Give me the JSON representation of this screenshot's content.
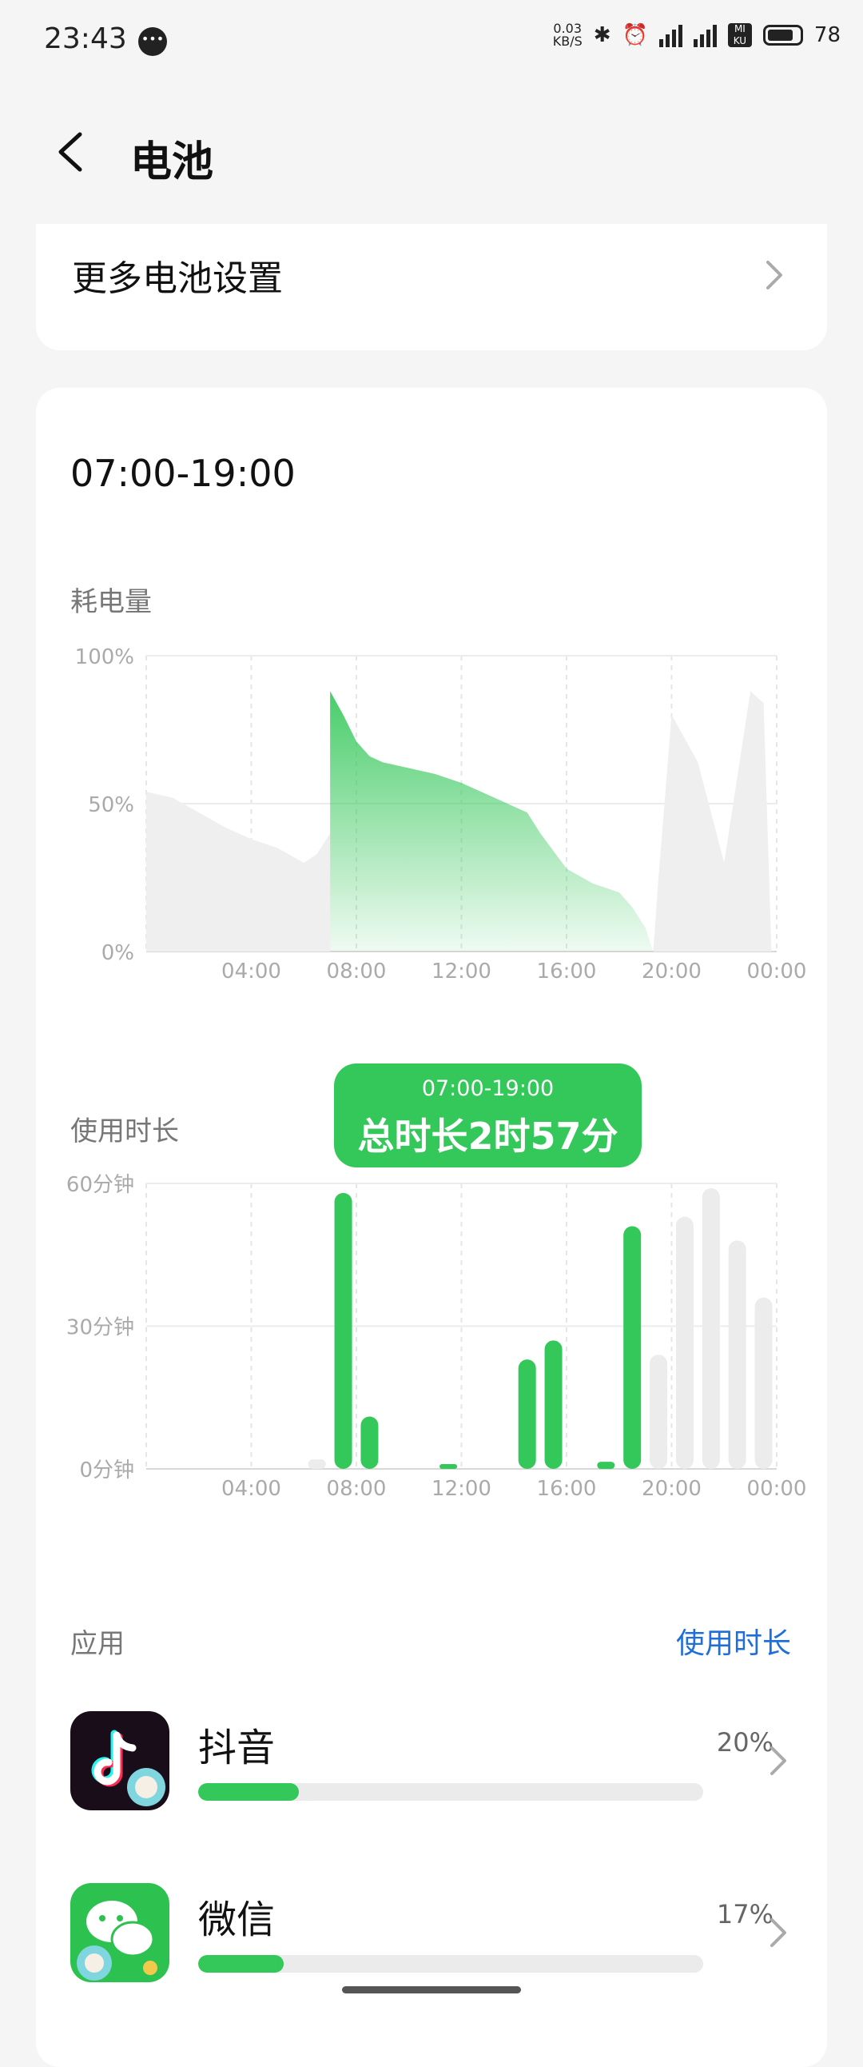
{
  "status_bar": {
    "time": "23:43",
    "net_speed_value": "0.03",
    "net_speed_unit": "KB/S",
    "battery_level": "78",
    "icons": [
      "message-icon",
      "bluetooth-icon",
      "alarm-icon",
      "signal-icon",
      "signal-icon",
      "mi-icon",
      "battery-icon"
    ]
  },
  "header": {
    "title": "电池"
  },
  "more_settings": {
    "label": "更多电池设置"
  },
  "range_label": "07:00-19:00",
  "consumption": {
    "label": "耗电量",
    "chart_data": {
      "type": "area",
      "y_ticks": [
        "100%",
        "50%",
        "0%"
      ],
      "x_ticks": [
        "04:00",
        "08:00",
        "12:00",
        "16:00",
        "20:00",
        "00:00"
      ],
      "ylim": [
        0,
        100
      ],
      "grey_points": [
        [
          0,
          54
        ],
        [
          1,
          52
        ],
        [
          2,
          47
        ],
        [
          3,
          42
        ],
        [
          4,
          38
        ],
        [
          5,
          35
        ],
        [
          6,
          30
        ],
        [
          6.5,
          33
        ],
        [
          7,
          40
        ]
      ],
      "green_points": [
        [
          7,
          88
        ],
        [
          7.5,
          80
        ],
        [
          8,
          71
        ],
        [
          8.5,
          66
        ],
        [
          9,
          64
        ],
        [
          10,
          62
        ],
        [
          11,
          60
        ],
        [
          12,
          57
        ],
        [
          13,
          53
        ],
        [
          14,
          49
        ],
        [
          14.5,
          47
        ],
        [
          15,
          40
        ],
        [
          15.5,
          34
        ],
        [
          16,
          28
        ],
        [
          17,
          23
        ],
        [
          18,
          20
        ],
        [
          18.5,
          15
        ],
        [
          19,
          8
        ],
        [
          19.3,
          0
        ]
      ],
      "grey_future_points": [
        [
          19.3,
          0
        ],
        [
          19.5,
          25
        ],
        [
          20,
          80
        ],
        [
          21,
          64
        ],
        [
          22,
          30
        ],
        [
          23,
          88
        ],
        [
          23.5,
          84
        ],
        [
          23.8,
          0
        ]
      ]
    }
  },
  "usage": {
    "label": "使用时长",
    "tooltip": {
      "range": "07:00-19:00",
      "total": "总时长2时57分"
    },
    "chart_data": {
      "type": "bar",
      "y_ticks": [
        "60分钟",
        "30分钟",
        "0分钟"
      ],
      "x_ticks": [
        "04:00",
        "08:00",
        "12:00",
        "16:00",
        "20:00",
        "00:00"
      ],
      "ylim": [
        0,
        60
      ],
      "bars": [
        {
          "hour": 6,
          "minutes": 2,
          "active": false
        },
        {
          "hour": 7,
          "minutes": 58,
          "active": true
        },
        {
          "hour": 8,
          "minutes": 11,
          "active": true
        },
        {
          "hour": 11,
          "minutes": 0.5,
          "active": true
        },
        {
          "hour": 14,
          "minutes": 23,
          "active": true
        },
        {
          "hour": 15,
          "minutes": 27,
          "active": true
        },
        {
          "hour": 17,
          "minutes": 1.5,
          "active": true
        },
        {
          "hour": 18,
          "minutes": 51,
          "active": true
        },
        {
          "hour": 19,
          "minutes": 24,
          "active": false
        },
        {
          "hour": 20,
          "minutes": 53,
          "active": false
        },
        {
          "hour": 21,
          "minutes": 59,
          "active": false
        },
        {
          "hour": 22,
          "minutes": 48,
          "active": false
        },
        {
          "hour": 23,
          "minutes": 36,
          "active": false
        }
      ]
    }
  },
  "apps": {
    "label": "应用",
    "sort_label": "使用时长",
    "items": [
      {
        "name": "抖音",
        "percent": "20%",
        "fraction": 0.2,
        "icon": "douyin-icon"
      },
      {
        "name": "微信",
        "percent": "17%",
        "fraction": 0.17,
        "icon": "wechat-icon"
      }
    ]
  },
  "colors": {
    "accent": "#34c759",
    "link": "#1e6fd9",
    "grey_bar": "#ececec"
  }
}
